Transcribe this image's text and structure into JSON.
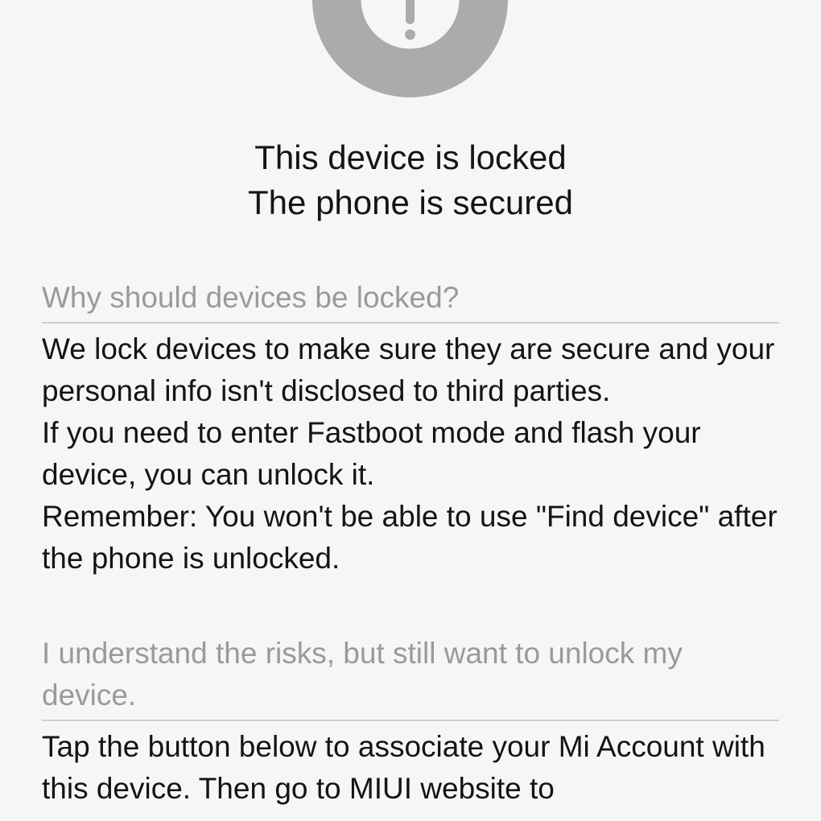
{
  "status": {
    "icon": "exclamation-icon",
    "icon_color": "#ababab",
    "icon_inner_color": "#f6f6f6",
    "line1": "This device is locked",
    "line2": "The phone is secured"
  },
  "why_section": {
    "header": "Why should devices be locked?",
    "paragraph1": "We lock devices to make sure they are secure and your personal info isn't disclosed to third parties.",
    "paragraph2": "If you need to enter Fastboot mode and flash your device, you can unlock it.",
    "paragraph3": "Remember: You won't be able to use \"Find device\" after the phone is unlocked."
  },
  "unlock_section": {
    "header": "I understand the risks, but still want to unlock my device.",
    "body": "Tap the button below to associate your Mi Account with this device. Then go to MIUI website to"
  }
}
